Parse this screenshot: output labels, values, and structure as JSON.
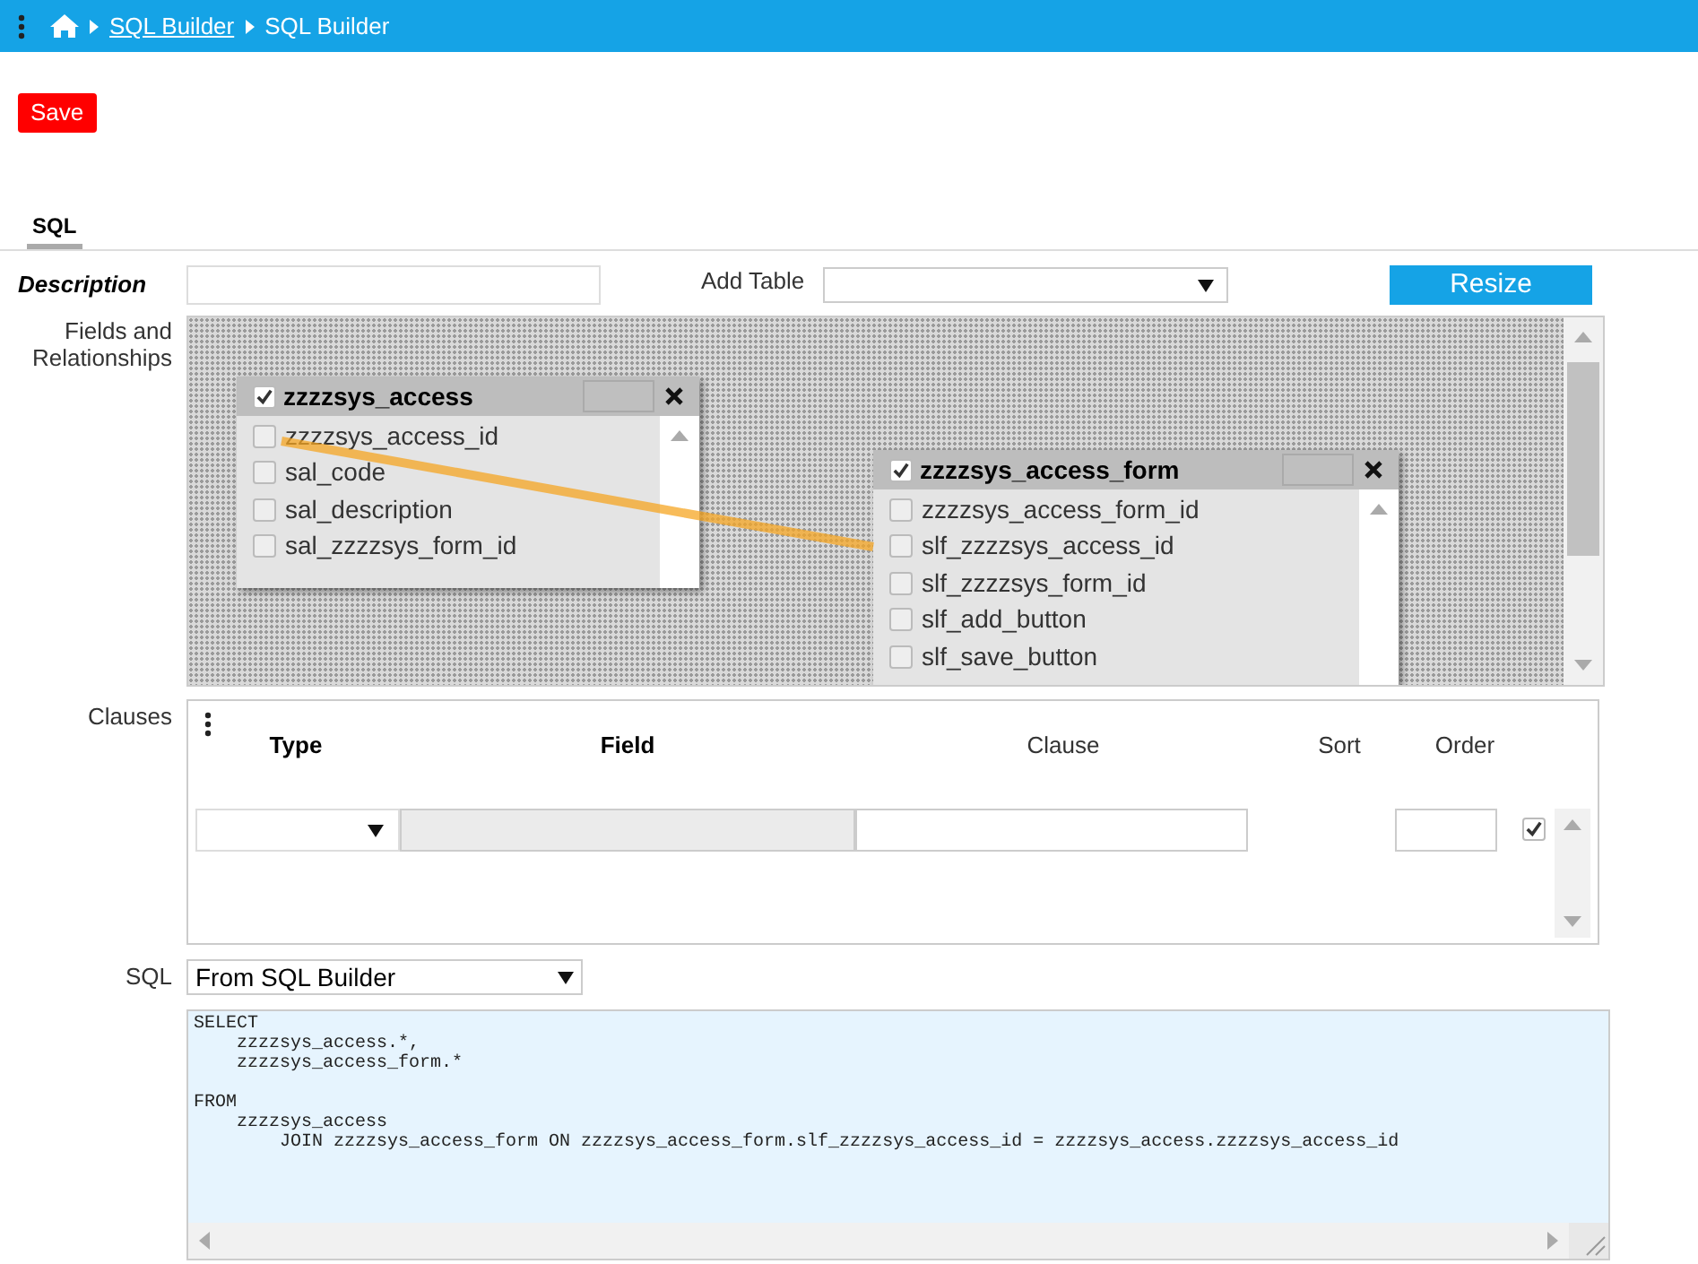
{
  "breadcrumb": [
    {
      "label": "SQL Builder",
      "link": true
    },
    {
      "label": "SQL Builder",
      "link": false
    }
  ],
  "save_button": "Save",
  "tabs": [
    {
      "label": "SQL",
      "selected": true
    }
  ],
  "description": {
    "label": "Description"
  },
  "add_table": {
    "label": "Add Table"
  },
  "resize_button": "Resize",
  "fields_label": "Fields and Relationships",
  "tables": [
    {
      "name": "zzzzsys_access",
      "checked": true,
      "fields": [
        {
          "name": "zzzzsys_access_id",
          "checked": false
        },
        {
          "name": "sal_code",
          "checked": false
        },
        {
          "name": "sal_description",
          "checked": false
        },
        {
          "name": "sal_zzzzsys_form_id",
          "checked": false
        }
      ]
    },
    {
      "name": "zzzzsys_access_form",
      "checked": true,
      "fields": [
        {
          "name": "zzzzsys_access_form_id",
          "checked": false
        },
        {
          "name": "slf_zzzzsys_access_id",
          "checked": false
        },
        {
          "name": "slf_zzzzsys_form_id",
          "checked": false
        },
        {
          "name": "slf_add_button",
          "checked": false
        },
        {
          "name": "slf_save_button",
          "checked": false
        }
      ]
    }
  ],
  "clauses": {
    "label": "Clauses",
    "columns": [
      "Type",
      "Field",
      "Clause",
      "Sort",
      "Order"
    ],
    "rows": [
      {
        "checked": true
      }
    ]
  },
  "sql": {
    "label": "SQL",
    "source": "From SQL Builder",
    "text": "SELECT\n    zzzzsys_access.*,\n    zzzzsys_access_form.*\n\nFROM\n    zzzzsys_access\n        JOIN zzzzsys_access_form ON zzzzsys_access_form.slf_zzzzsys_access_id = zzzzsys_access.zzzzsys_access_id"
  }
}
